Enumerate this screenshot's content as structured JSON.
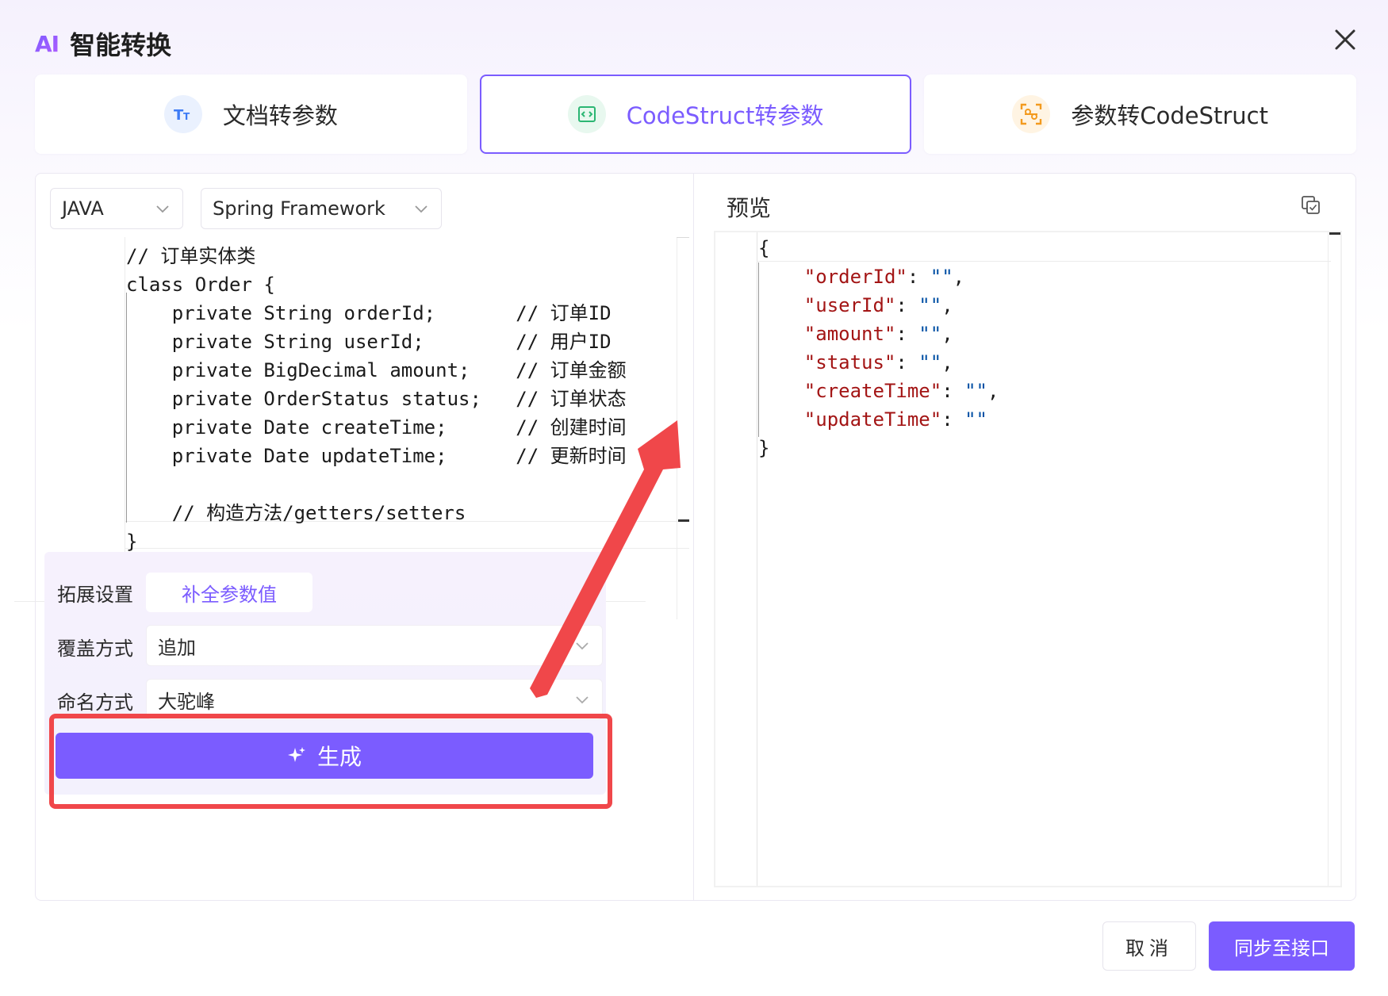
{
  "header": {
    "logo_text": "AI",
    "title": "智能转换"
  },
  "tabs": [
    {
      "label": "文档转参数",
      "icon": "text-format-icon",
      "icon_color": "#3d7bf5",
      "icon_bg": "#eaf1fe",
      "active": false
    },
    {
      "label": "CodeStruct转参数",
      "icon": "code-icon",
      "icon_color": "#2bb673",
      "icon_bg": "#e8f8ef",
      "active": true
    },
    {
      "label": "参数转CodeStruct",
      "icon": "scan-convert-icon",
      "icon_color": "#f39a1e",
      "icon_bg": "#fff4e3",
      "active": false
    }
  ],
  "left_panel": {
    "language_select": {
      "value": "JAVA"
    },
    "framework_select": {
      "value": "Spring Framework"
    },
    "code_lines": [
      "// 订单实体类",
      "class Order {",
      "    private String orderId;       // 订单ID",
      "    private String userId;        // 用户ID",
      "    private BigDecimal amount;    // 订单金额",
      "    private OrderStatus status;   // 订单状态",
      "    private Date createTime;      // 创建时间",
      "    private Date updateTime;      // 更新时间",
      "",
      "    // 构造方法/getters/setters",
      "}"
    ]
  },
  "settings": {
    "extension_label": "拓展设置",
    "extension_chip": "补全参数值",
    "overwrite_label": "覆盖方式",
    "overwrite_value": "追加",
    "naming_label": "命名方式",
    "naming_value": "大驼峰",
    "generate_label": "生成"
  },
  "preview": {
    "title": "预览",
    "json_lines": [
      {
        "indent": "",
        "key": "",
        "value": "",
        "raw": "{"
      },
      {
        "indent": "    ",
        "key": "\"orderId\"",
        "value": "\"\"",
        "suffix": ","
      },
      {
        "indent": "    ",
        "key": "\"userId\"",
        "value": "\"\"",
        "suffix": ","
      },
      {
        "indent": "    ",
        "key": "\"amount\"",
        "value": "\"\"",
        "suffix": ","
      },
      {
        "indent": "    ",
        "key": "\"status\"",
        "value": "\"\"",
        "suffix": ","
      },
      {
        "indent": "    ",
        "key": "\"createTime\"",
        "value": "\"\"",
        "suffix": ","
      },
      {
        "indent": "    ",
        "key": "\"updateTime\"",
        "value": "\"\"",
        "suffix": ""
      },
      {
        "indent": "",
        "key": "",
        "value": "",
        "raw": "}"
      }
    ]
  },
  "footer": {
    "cancel_label": "取消",
    "sync_label": "同步至接口"
  },
  "colors": {
    "accent": "#7b5cff",
    "annotation_red": "#f0474a"
  }
}
